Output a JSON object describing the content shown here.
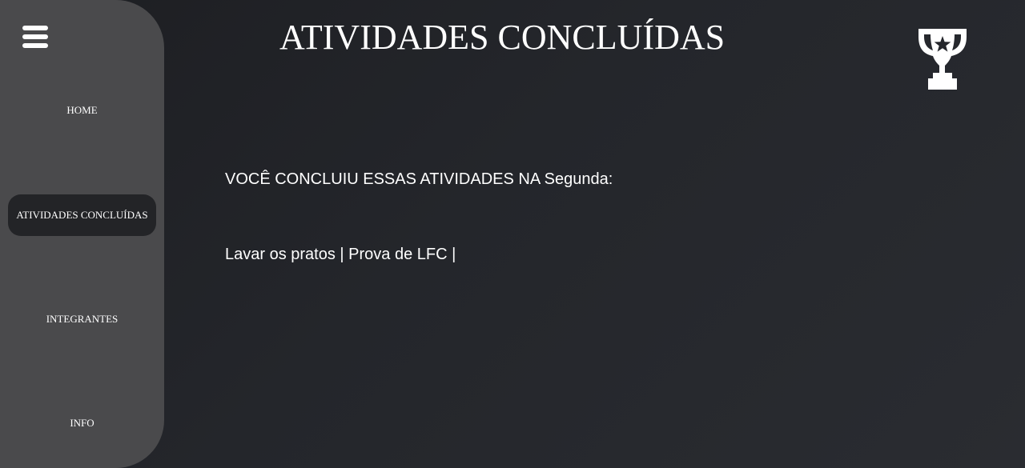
{
  "sidebar": {
    "items": [
      {
        "label": "HOME",
        "active": false
      },
      {
        "label": "ATIVIDADES CONCLUÍDAS",
        "active": true
      },
      {
        "label": "INTEGRANTES",
        "active": false
      },
      {
        "label": "INFO",
        "active": false
      }
    ],
    "menu_icon": "hamburger-menu-icon"
  },
  "header": {
    "title": "ATIVIDADES CONCLUÍDAS",
    "icon": "trophy-star-icon"
  },
  "main": {
    "heading_prefix": "VOCÊ CONCLUIU ESSAS ATIVIDADES NA ",
    "day": "Segunda",
    "heading_suffix": ":",
    "activities": [
      "Lavar os pratos",
      "Prova de LFC"
    ],
    "separator": " | "
  },
  "colors": {
    "background": "#24262b",
    "sidebar": "#4a4a4c",
    "active_item": "#232427",
    "text": "#ffffff"
  }
}
